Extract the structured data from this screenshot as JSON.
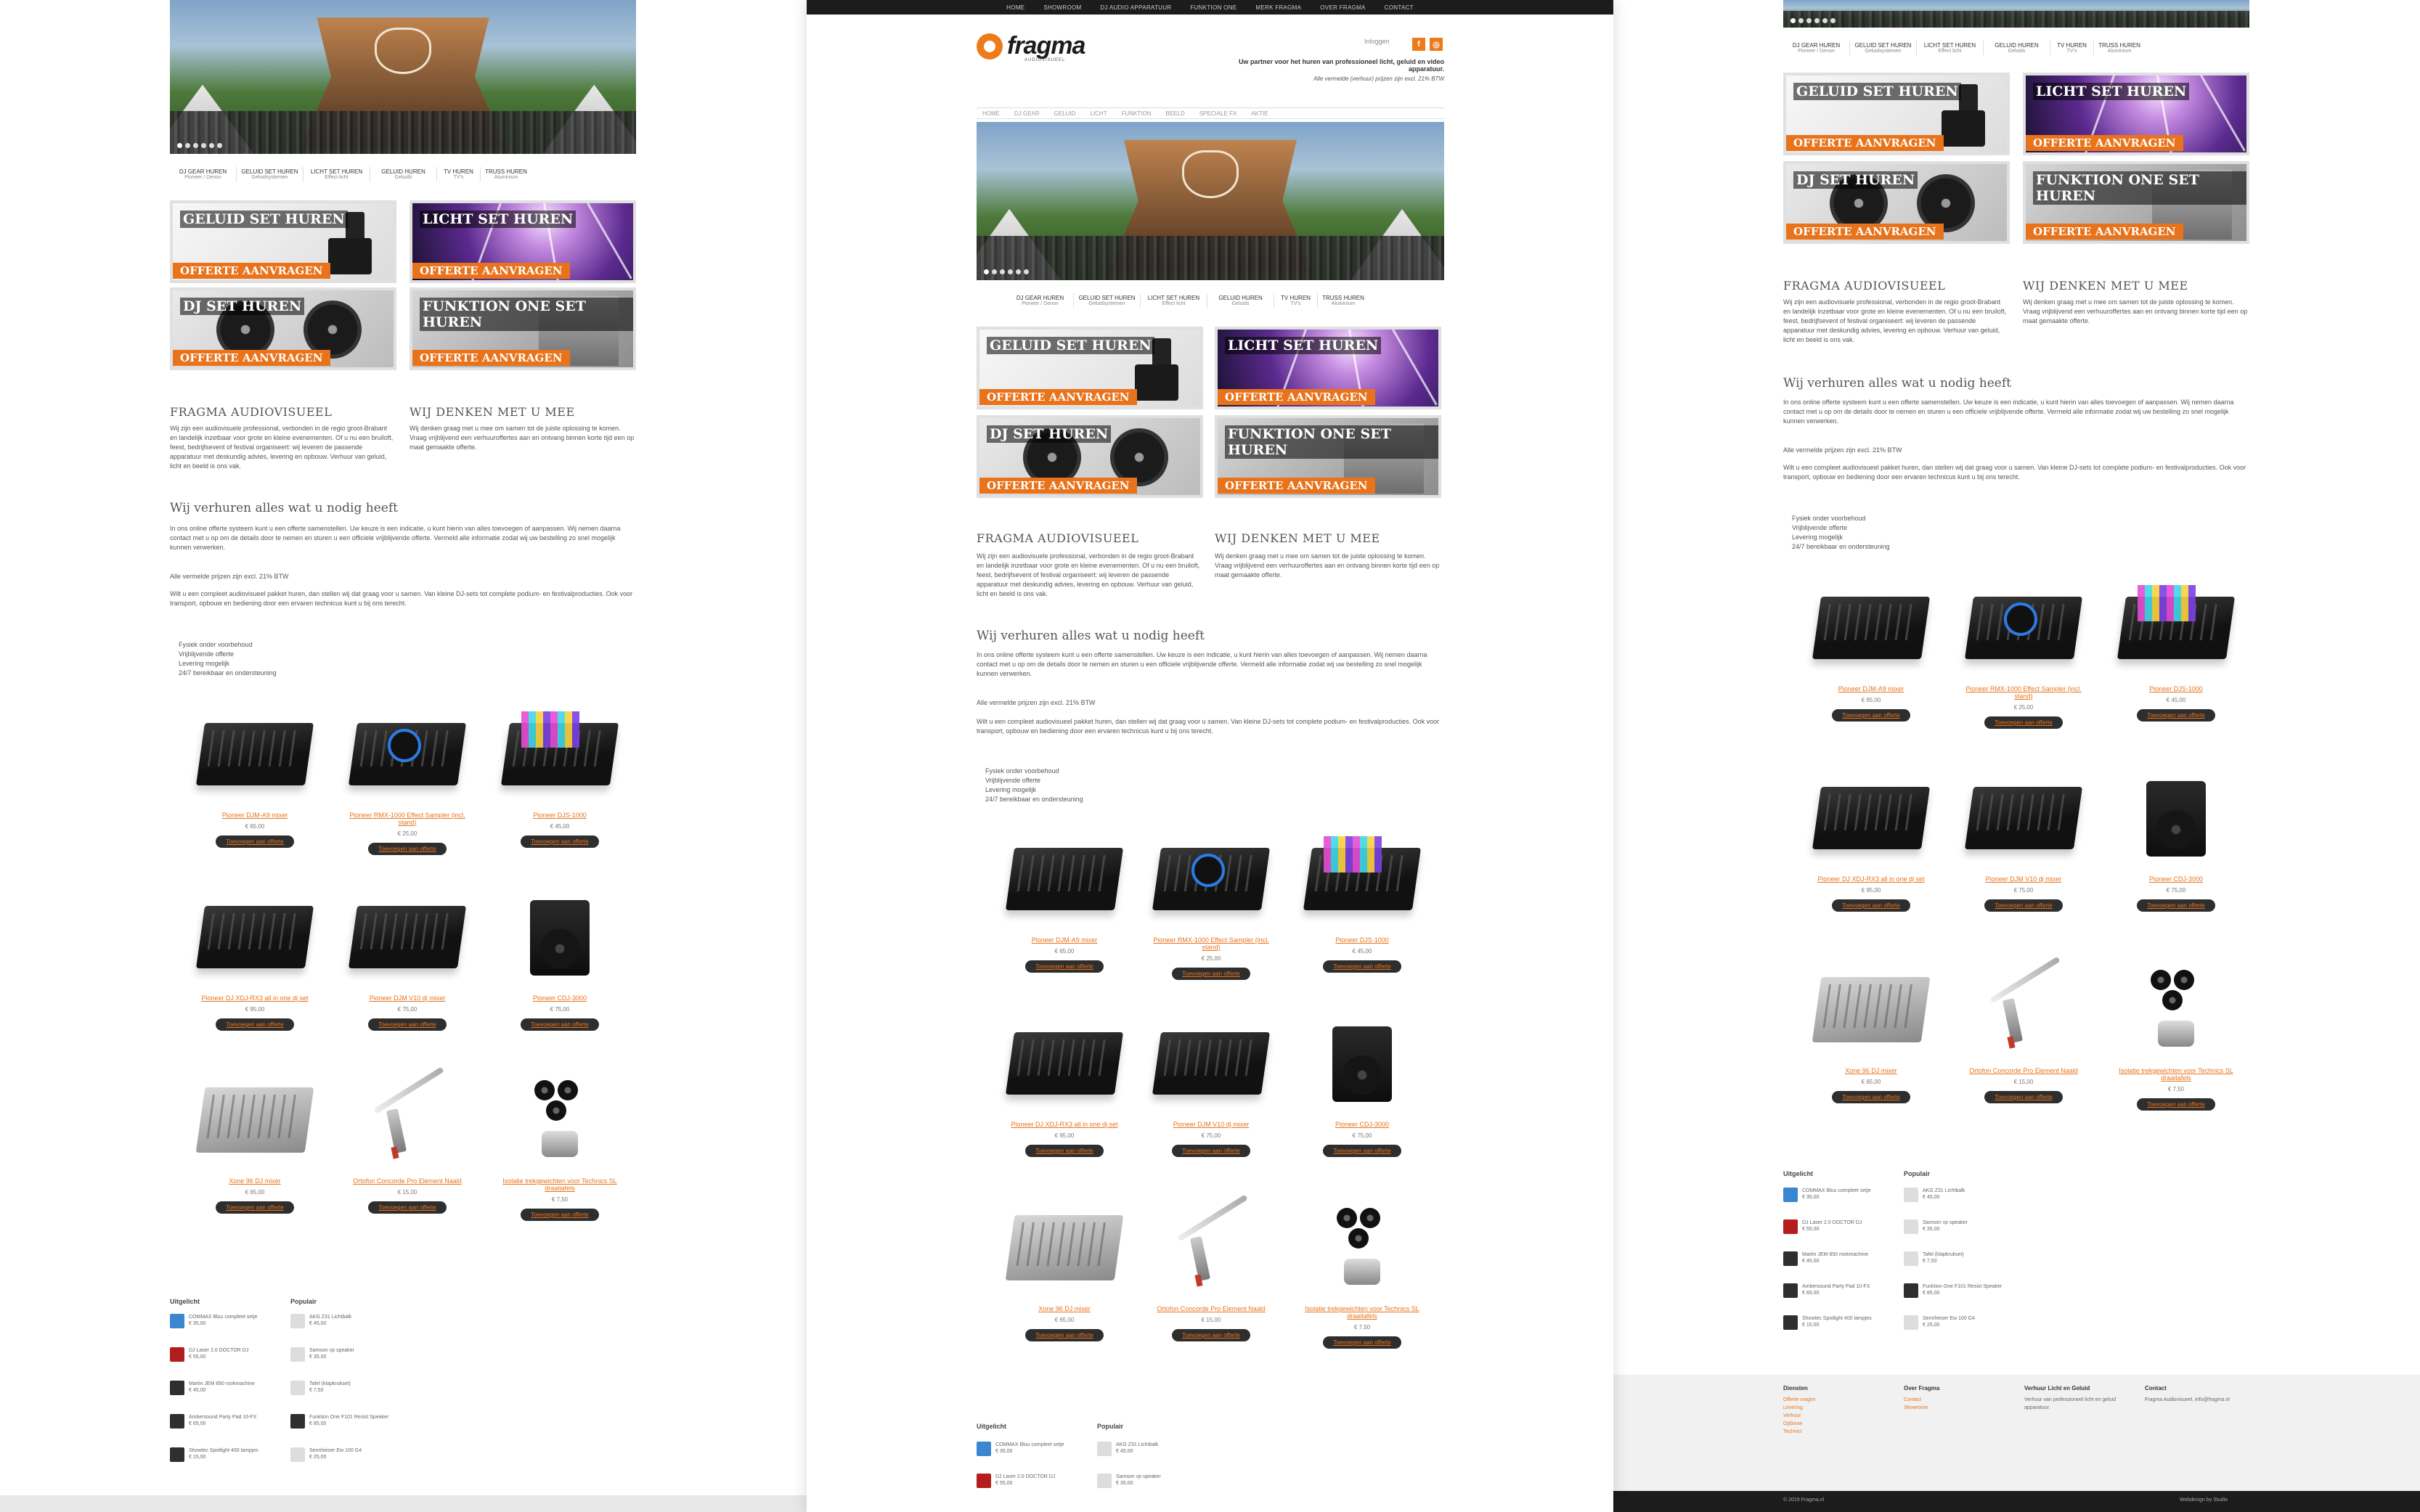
{
  "topnav": [
    "Home",
    "Showroom",
    "DJ Audio Apparatuur",
    "Funktion One",
    "Merk Fragma",
    "Over Fragma",
    "Contact"
  ],
  "header": {
    "logo_text": "fragma",
    "logo_sub": "AUDIOVISUEEL",
    "login": "Inloggen",
    "tagline": "Uw partner voor het huren van professioneel licht, geluid en video apparatuur.",
    "tagline2": "Alle vermelde (verhuur) prijzen zijn excl. 21% BTW"
  },
  "mainnav": [
    "Home",
    "DJ Gear",
    "Geluid",
    "Licht",
    "Funktion",
    "Beeld",
    "Speciale FX",
    "Aktie"
  ],
  "categories": [
    {
      "title": "DJ Gear Huren",
      "sub": "Pioneer / Denon"
    },
    {
      "title": "Geluid Set Huren",
      "sub": "Geluidsystemen"
    },
    {
      "title": "Licht Set Huren",
      "sub": "Effect licht"
    },
    {
      "title": "Geluid Huren",
      "sub": "Geluids"
    },
    {
      "title": "TV Huren",
      "sub": "TV's"
    },
    {
      "title": "Truss Huren",
      "sub": "Aluminium"
    }
  ],
  "banners": [
    {
      "title": "Geluid Set Huren",
      "cta": "Offerte aanvragen"
    },
    {
      "title": "Licht Set Huren",
      "cta": "Offerte aanvragen"
    },
    {
      "title": "DJ Set Huren",
      "cta": "Offerte aanvragen"
    },
    {
      "title": "Funktion One Set Huren",
      "cta": "Offerte aanvragen"
    }
  ],
  "about": {
    "title": "Fragma Audiovisueel",
    "text": "Wij zijn een audiovisuele professional, verbonden in de regio groot-Brabant en landelijk inzetbaar voor grote en kleine evenementen. Of u nu een bruiloft, feest, bedrijfsevent of festival organiseert: wij leveren de passende apparatuur met deskundig advies, levering en opbouw. Verhuur van geluid, licht en beeld is ons vak.",
    "bold": "audiovisuele professional"
  },
  "think": {
    "title": "Wij denken met u mee",
    "text": "Wij denken graag met u mee om samen tot de juiste oplossing te komen. Vraag vrijblijvend een verhuuroffertes aan en ontvang binnen korte tijd een op maat gemaakte offerte."
  },
  "needs": {
    "title": "Wij verhuren alles wat u nodig heeft",
    "text": "In ons online offerte systeem kunt u een offerte samenstellen. Uw keuze is een indicatie, u kunt hierin van alles toevoegen of aanpassen. Wij nemen daarna contact met u op om de details door te nemen en sturen u een officiele vrijblijvende offerte. Vermeld alle informatie zodat wij uw bestelling zo snel mogelijk kunnen verwerken.",
    "vat": "Alle vermelde prijzen zijn excl. 21% BTW",
    "text2": "Wilt u een compleet audiovisueel pakket huren, dan stellen wij dat graag voor u samen. Van kleine DJ-sets tot complete podium- en festivalproducties. Ook voor transport, opbouw en bediening door een ervaren technicus kunt u bij ons terecht.",
    "list": [
      "Fysiek onder voorbehoud",
      "Vrijblijvende offerte",
      "Levering mogelijk",
      "24/7 bereikbaar en ondersteuning"
    ]
  },
  "products": [
    {
      "name": "Pioneer DJM-A9 mixer",
      "price": "€ 65,00",
      "button": "Toevoegen aan offerte"
    },
    {
      "name": "Pioneer RMX-1000 Effect Sampler (incl. stand)",
      "price": "€ 25,00",
      "button": "Toevoegen aan offerte"
    },
    {
      "name": "Pioneer DJS-1000",
      "price": "€ 45,00",
      "button": "Toevoegen aan offerte"
    },
    {
      "name": "Pioneer DJ XDJ-RX3 all in one dj set",
      "price": "€ 95,00",
      "button": "Toevoegen aan offerte"
    },
    {
      "name": "Pioneer DJM V10 dj mixer",
      "price": "€ 75,00",
      "button": "Toevoegen aan offerte"
    },
    {
      "name": "Pioneer CDJ-3000",
      "price": "€ 75,00",
      "button": "Toevoegen aan offerte"
    },
    {
      "name": "Xone 96 DJ mixer",
      "price": "€ 65,00",
      "button": "Toevoegen aan offerte"
    },
    {
      "name": "Ortofon Concorde Pro Element Naald",
      "price": "€ 15,00",
      "button": "Toevoegen aan offerte"
    },
    {
      "name": "Isolatie trekgewichten voor Technics SL draaitafels",
      "price": "€ 7,50",
      "button": "Toevoegen aan offerte"
    }
  ],
  "widgets": {
    "uitgelicht": {
      "title": "Uitgelicht",
      "items": [
        {
          "text": "COMMAX Bluu compleet setje",
          "price": "€ 35,00"
        },
        {
          "text": "DJ Laser 2.0 DOCTOR DJ",
          "price": "€ 55,00"
        },
        {
          "text": "Martin JEM 850 rookmachine",
          "price": "€ 45,00"
        },
        {
          "text": "Ambersound Party Pad 10-FX",
          "price": "€ 65,00"
        },
        {
          "text": "Showtec Spotlight 400 lampjes",
          "price": "€ 15,00"
        }
      ]
    },
    "populair": {
      "title": "Populair",
      "items": [
        {
          "text": "AKG Z31 Lichtbalk",
          "price": "€ 45,00"
        },
        {
          "text": "Samson vp speaker",
          "price": "€ 35,00"
        },
        {
          "text": "Tafel (klapkrukset)",
          "price": "€ 7,50"
        },
        {
          "text": "Funktion One F101 Resist Speaker",
          "price": "€ 85,00"
        },
        {
          "text": "Sennheiser Ew 100 G4",
          "price": "€ 25,00"
        }
      ]
    }
  },
  "footer": {
    "cols": [
      {
        "title": "Diensten",
        "links": [
          "Offerte vragen",
          "Levering",
          "Verhuur",
          "Opbouw",
          "Technici"
        ]
      },
      {
        "title": "Over Fragma",
        "links": [
          "Contact",
          "Showroom"
        ]
      },
      {
        "title": "Verhuur Licht en Geluid",
        "text": "Verhuur van professioneel licht en geluid apparatuur."
      },
      {
        "title": "Contact",
        "text": "Fragma Audiovisueel, info@fragma.nl"
      }
    ],
    "copyright": "© 2019 Fragma.nl",
    "credit": "Webdesign by Studio"
  },
  "colors": {
    "accent": "#e9731b",
    "dark": "#1c1c1c"
  }
}
